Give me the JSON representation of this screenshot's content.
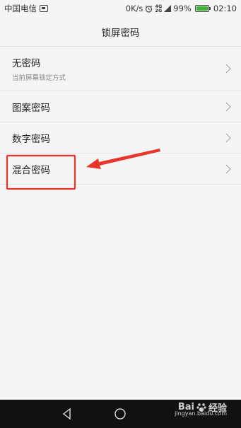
{
  "status_bar": {
    "carrier": "中国电信",
    "speed": "0K/s",
    "network": "4G",
    "battery_percent": "99%",
    "time": "02:10",
    "battery_level": 0.99,
    "icons": [
      "sim-card-icon",
      "alarm-icon",
      "signal-4g-icon",
      "battery-charging-icon"
    ]
  },
  "header": {
    "title": "锁屏密码"
  },
  "lock_options": [
    {
      "label": "无密码",
      "subtitle": "当前屏幕锁定方式"
    },
    {
      "label": "图案密码"
    },
    {
      "label": "数字密码"
    },
    {
      "label": "混合密码"
    }
  ],
  "annotation": {
    "color": "#e8362b",
    "highlighted_option": "混合密码"
  },
  "nav_bar": {
    "buttons": [
      "back-icon",
      "home-icon"
    ]
  },
  "watermark": {
    "text": "Bai",
    "suffix": "经验",
    "url": "jingyan.baidu.com"
  }
}
